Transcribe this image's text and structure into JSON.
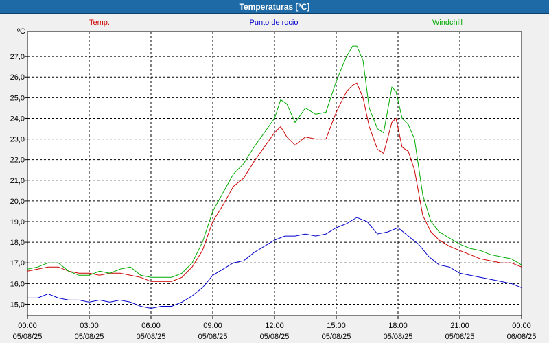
{
  "window": {
    "title": "Temperaturas [ºC]"
  },
  "chart_data": {
    "type": "line",
    "title": "Temperaturas [ºC]",
    "ylabel": "ºC",
    "xlabel": "",
    "ylim": [
      14.45,
      28.2
    ],
    "xlim": [
      0,
      24
    ],
    "grid": true,
    "legend_placement": "top",
    "y_ticks": [
      "15,0",
      "16,0",
      "17,0",
      "18,0",
      "19,0",
      "20,0",
      "21,0",
      "22,0",
      "23,0",
      "24,0",
      "25,0",
      "26,0",
      "27,0"
    ],
    "x_ticks": [
      {
        "time": "00:00",
        "date": "05/08/25"
      },
      {
        "time": "03:00",
        "date": "05/08/25"
      },
      {
        "time": "06:00",
        "date": "05/08/25"
      },
      {
        "time": "09:00",
        "date": "05/08/25"
      },
      {
        "time": "12:00",
        "date": "05/08/25"
      },
      {
        "time": "15:00",
        "date": "05/08/25"
      },
      {
        "time": "18:00",
        "date": "05/08/25"
      },
      {
        "time": "21:00",
        "date": "05/08/25"
      },
      {
        "time": "00:00",
        "date": "06/08/25"
      }
    ],
    "series": [
      {
        "name": "Temp.",
        "color": "#cc0000",
        "points": [
          [
            0,
            16.6
          ],
          [
            0.5,
            16.7
          ],
          [
            1,
            16.8
          ],
          [
            1.5,
            16.8
          ],
          [
            2,
            16.6
          ],
          [
            2.5,
            16.5
          ],
          [
            3,
            16.5
          ],
          [
            3.5,
            16.4
          ],
          [
            4,
            16.5
          ],
          [
            4.5,
            16.5
          ],
          [
            5,
            16.4
          ],
          [
            5.5,
            16.3
          ],
          [
            6,
            16.1
          ],
          [
            6.5,
            16.1
          ],
          [
            7,
            16.1
          ],
          [
            7.5,
            16.3
          ],
          [
            8,
            16.8
          ],
          [
            8.5,
            17.6
          ],
          [
            9,
            19.0
          ],
          [
            9.5,
            19.8
          ],
          [
            10,
            20.7
          ],
          [
            10.5,
            21.1
          ],
          [
            11,
            21.9
          ],
          [
            11.5,
            22.6
          ],
          [
            12,
            23.3
          ],
          [
            12.3,
            23.6
          ],
          [
            12.6,
            23.1
          ],
          [
            13,
            22.7
          ],
          [
            13.5,
            23.1
          ],
          [
            14,
            23.0
          ],
          [
            14.5,
            23.0
          ],
          [
            15,
            24.3
          ],
          [
            15.5,
            25.3
          ],
          [
            15.8,
            25.6
          ],
          [
            16,
            25.7
          ],
          [
            16.3,
            25.0
          ],
          [
            16.6,
            23.6
          ],
          [
            17,
            22.5
          ],
          [
            17.3,
            22.3
          ],
          [
            17.7,
            23.8
          ],
          [
            17.9,
            24.0
          ],
          [
            18.2,
            22.6
          ],
          [
            18.5,
            22.4
          ],
          [
            18.8,
            21.5
          ],
          [
            19.2,
            19.3
          ],
          [
            19.6,
            18.5
          ],
          [
            20,
            18.1
          ],
          [
            20.5,
            17.8
          ],
          [
            21,
            17.6
          ],
          [
            21.5,
            17.4
          ],
          [
            22,
            17.2
          ],
          [
            22.5,
            17.1
          ],
          [
            23,
            17.0
          ],
          [
            23.5,
            17.0
          ],
          [
            24,
            16.8
          ]
        ]
      },
      {
        "name": "Punto de rocio",
        "color": "#0000cc",
        "points": [
          [
            0,
            15.3
          ],
          [
            0.5,
            15.3
          ],
          [
            1,
            15.5
          ],
          [
            1.5,
            15.3
          ],
          [
            2,
            15.2
          ],
          [
            2.5,
            15.2
          ],
          [
            3,
            15.1
          ],
          [
            3.5,
            15.2
          ],
          [
            4,
            15.1
          ],
          [
            4.5,
            15.2
          ],
          [
            5,
            15.1
          ],
          [
            5.5,
            14.9
          ],
          [
            6,
            14.8
          ],
          [
            6.5,
            14.9
          ],
          [
            7,
            14.9
          ],
          [
            7.5,
            15.1
          ],
          [
            8,
            15.4
          ],
          [
            8.5,
            15.8
          ],
          [
            9,
            16.4
          ],
          [
            9.5,
            16.7
          ],
          [
            10,
            17.0
          ],
          [
            10.5,
            17.1
          ],
          [
            11,
            17.5
          ],
          [
            11.5,
            17.8
          ],
          [
            12,
            18.1
          ],
          [
            12.5,
            18.3
          ],
          [
            13,
            18.3
          ],
          [
            13.5,
            18.4
          ],
          [
            14,
            18.3
          ],
          [
            14.5,
            18.4
          ],
          [
            15,
            18.7
          ],
          [
            15.5,
            18.9
          ],
          [
            16,
            19.2
          ],
          [
            16.5,
            19.0
          ],
          [
            17,
            18.4
          ],
          [
            17.5,
            18.5
          ],
          [
            18,
            18.7
          ],
          [
            18.5,
            18.3
          ],
          [
            19,
            17.9
          ],
          [
            19.5,
            17.3
          ],
          [
            20,
            16.9
          ],
          [
            20.5,
            16.8
          ],
          [
            21,
            16.5
          ],
          [
            21.5,
            16.4
          ],
          [
            22,
            16.3
          ],
          [
            22.5,
            16.2
          ],
          [
            23,
            16.1
          ],
          [
            23.5,
            16.0
          ],
          [
            24,
            15.8
          ]
        ]
      },
      {
        "name": "Windchill",
        "color": "#00aa00",
        "points": [
          [
            0,
            16.7
          ],
          [
            0.5,
            16.8
          ],
          [
            1,
            17.0
          ],
          [
            1.5,
            17.0
          ],
          [
            2,
            16.6
          ],
          [
            2.5,
            16.4
          ],
          [
            3,
            16.4
          ],
          [
            3.5,
            16.6
          ],
          [
            4,
            16.5
          ],
          [
            4.5,
            16.7
          ],
          [
            5,
            16.8
          ],
          [
            5.5,
            16.4
          ],
          [
            6,
            16.3
          ],
          [
            6.5,
            16.3
          ],
          [
            7,
            16.3
          ],
          [
            7.5,
            16.5
          ],
          [
            8,
            17.0
          ],
          [
            8.5,
            18.0
          ],
          [
            9,
            19.5
          ],
          [
            9.5,
            20.4
          ],
          [
            10,
            21.3
          ],
          [
            10.5,
            21.8
          ],
          [
            11,
            22.6
          ],
          [
            11.5,
            23.3
          ],
          [
            12,
            24.0
          ],
          [
            12.3,
            24.9
          ],
          [
            12.6,
            24.7
          ],
          [
            13,
            23.8
          ],
          [
            13.5,
            24.5
          ],
          [
            14,
            24.2
          ],
          [
            14.5,
            24.3
          ],
          [
            15,
            25.8
          ],
          [
            15.5,
            27.0
          ],
          [
            15.8,
            27.5
          ],
          [
            16,
            27.5
          ],
          [
            16.3,
            26.8
          ],
          [
            16.6,
            24.5
          ],
          [
            17,
            23.5
          ],
          [
            17.3,
            23.3
          ],
          [
            17.7,
            25.5
          ],
          [
            17.9,
            25.3
          ],
          [
            18.2,
            24.0
          ],
          [
            18.5,
            23.7
          ],
          [
            18.8,
            23.0
          ],
          [
            19.2,
            20.3
          ],
          [
            19.6,
            19.0
          ],
          [
            20,
            18.5
          ],
          [
            20.5,
            18.2
          ],
          [
            21,
            17.9
          ],
          [
            21.5,
            17.7
          ],
          [
            22,
            17.6
          ],
          [
            22.5,
            17.4
          ],
          [
            23,
            17.3
          ],
          [
            23.5,
            17.2
          ],
          [
            24,
            16.9
          ]
        ]
      }
    ]
  }
}
